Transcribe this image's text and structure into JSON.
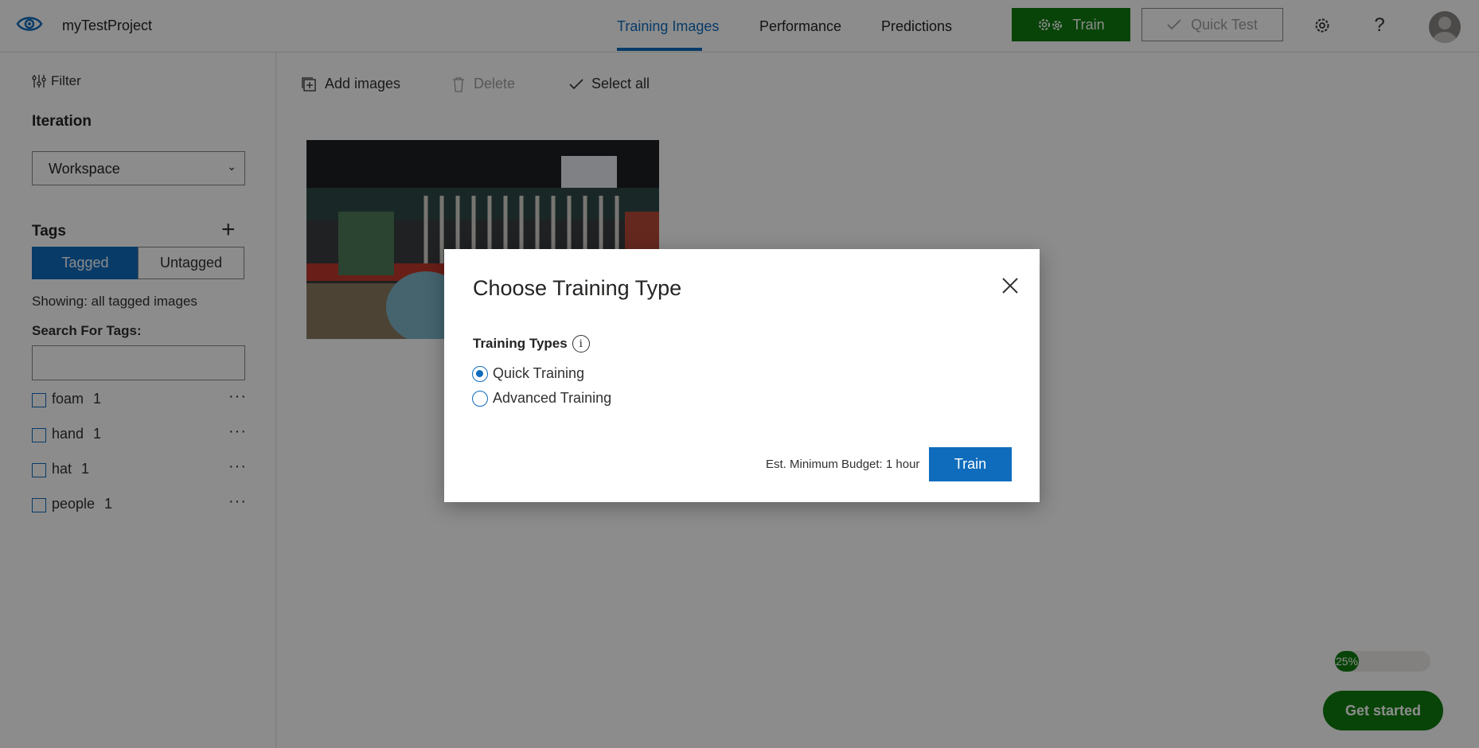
{
  "header": {
    "project_name": "myTestProject",
    "tabs": [
      {
        "label": "Training Images",
        "active": true
      },
      {
        "label": "Performance",
        "active": false
      },
      {
        "label": "Predictions",
        "active": false
      }
    ],
    "train_label": "Train",
    "quick_test_label": "Quick Test",
    "icons": [
      "eye-logo-icon",
      "gears-icon",
      "checkmark-icon",
      "gear-icon",
      "help-icon",
      "avatar-icon"
    ]
  },
  "sidebar": {
    "filter_label": "Filter",
    "iteration_title": "Iteration",
    "iteration_value": "Workspace",
    "tags_title": "Tags",
    "tagged_label": "Tagged",
    "untagged_label": "Untagged",
    "showing_text": "Showing: all tagged images",
    "search_label": "Search For Tags:",
    "search_value": "",
    "tags": [
      {
        "name": "foam",
        "count": "1"
      },
      {
        "name": "hand",
        "count": "1"
      },
      {
        "name": "hat",
        "count": "1"
      },
      {
        "name": "people",
        "count": "1"
      }
    ]
  },
  "toolbar": {
    "add_images": "Add images",
    "delete": "Delete",
    "select_all": "Select all"
  },
  "progress": {
    "label": "25%",
    "value": 0.25
  },
  "get_started_label": "Get started",
  "modal": {
    "title": "Choose Training Type",
    "types_label": "Training Types",
    "options": [
      {
        "label": "Quick Training",
        "checked": true
      },
      {
        "label": "Advanced Training",
        "checked": false
      }
    ],
    "budget_text": "Est. Minimum Budget: 1 hour",
    "train_label": "Train"
  },
  "colors": {
    "accent_blue": "#0f6cbd",
    "train_green": "#107c10",
    "overlay": "rgba(0,0,0,0.45)"
  }
}
